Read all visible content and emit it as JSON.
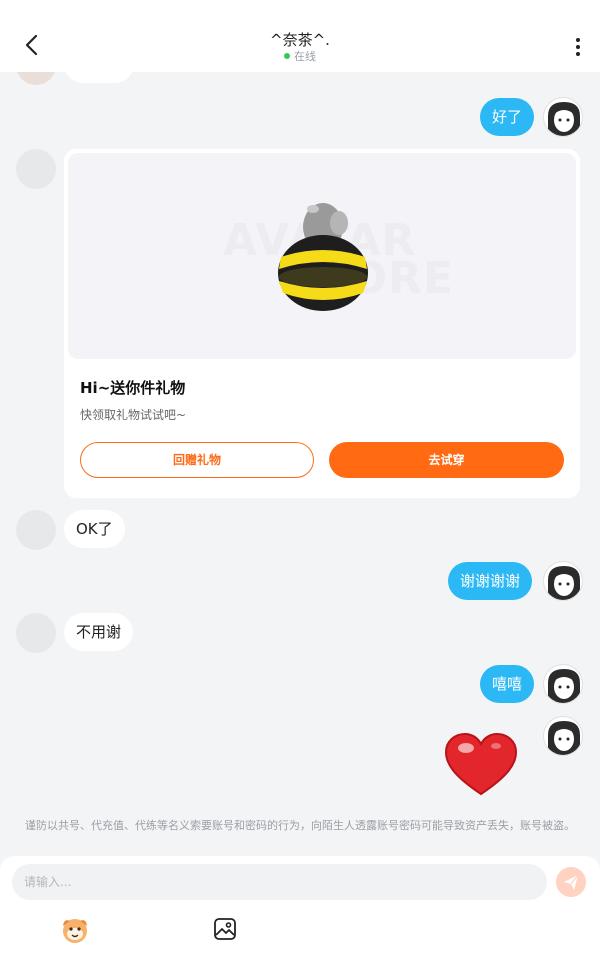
{
  "header": {
    "title": "^奈茶^.",
    "status": "在线"
  },
  "messages": {
    "m1": "好了",
    "m2": "OK了",
    "m3": "谢谢谢谢",
    "m4": "不用谢",
    "m5": "嘻嘻"
  },
  "gift_card": {
    "title": "Hi~送你件礼物",
    "subtitle": "快领取礼物试试吧~",
    "watermark_line1": "AVATAR",
    "watermark_line2": "STORE",
    "return_gift_label": "回赠礼物",
    "try_on_label": "去试穿"
  },
  "notice": "谨防以共号、代充值、代练等名义索要账号和密码的行为，向陌生人透露账号密码可能导致资产丢失，账号被盗。",
  "composer": {
    "placeholder": "请输入..."
  },
  "colors": {
    "my_bubble": "#2bb8f5",
    "accent_orange": "#ff6a13",
    "online_dot": "#34c759"
  },
  "icons": [
    "back-arrow-icon",
    "more-vertical-icon",
    "send-icon",
    "emoji-face-icon",
    "image-icon",
    "heart-sticker-icon"
  ]
}
